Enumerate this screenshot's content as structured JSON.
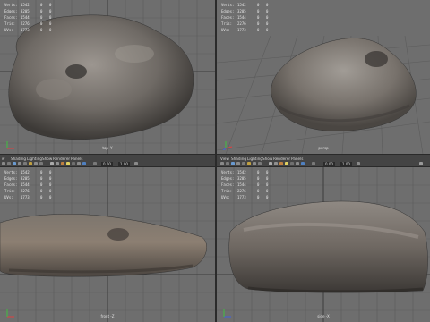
{
  "stats_labels": [
    "Verts:",
    "Edges:",
    "Faces:",
    "Tris:",
    "UVs:"
  ],
  "viewports": {
    "top": {
      "camera": "top -Y",
      "rows": [
        {
          "v1": "1542",
          "v2": "0",
          "v3": "0"
        },
        {
          "v1": "3205",
          "v2": "0",
          "v3": "0"
        },
        {
          "v1": "1544",
          "v2": "0",
          "v3": "0"
        },
        {
          "v1": "2276",
          "v2": "0",
          "v3": "0"
        },
        {
          "v1": "1773",
          "v2": "0",
          "v3": "0"
        }
      ]
    },
    "persp": {
      "camera": "persp",
      "rows": [
        {
          "v1": "1542",
          "v2": "0",
          "v3": "0"
        },
        {
          "v1": "3205",
          "v2": "0",
          "v3": "0"
        },
        {
          "v1": "1544",
          "v2": "0",
          "v3": "0"
        },
        {
          "v1": "2276",
          "v2": "0",
          "v3": "0"
        },
        {
          "v1": "1773",
          "v2": "0",
          "v3": "0"
        }
      ]
    },
    "front": {
      "camera": "front -Z",
      "rows": [
        {
          "v1": "1542",
          "v2": "0",
          "v3": "0"
        },
        {
          "v1": "3205",
          "v2": "0",
          "v3": "0"
        },
        {
          "v1": "1544",
          "v2": "0",
          "v3": "0"
        },
        {
          "v1": "2276",
          "v2": "0",
          "v3": "0"
        },
        {
          "v1": "1773",
          "v2": "0",
          "v3": "0"
        }
      ]
    },
    "side": {
      "camera": "side -X",
      "rows": [
        {
          "v1": "1542",
          "v2": "0",
          "v3": "0"
        },
        {
          "v1": "3205",
          "v2": "0",
          "v3": "0"
        },
        {
          "v1": "1544",
          "v2": "0",
          "v3": "0"
        },
        {
          "v1": "2276",
          "v2": "0",
          "v3": "0"
        },
        {
          "v1": "1773",
          "v2": "0",
          "v3": "0"
        }
      ]
    }
  },
  "menus": {
    "left": [
      "w",
      "Shading",
      "Lighting",
      "Show",
      "Renderer",
      "Panels"
    ],
    "right": [
      "View",
      "Shading",
      "Lighting",
      "Show",
      "Renderer",
      "Panels"
    ]
  },
  "toolbar": {
    "left": {
      "field1": "0.00",
      "field2": "1.00"
    },
    "right": {
      "field1": "0.00",
      "field2": "1.00"
    }
  },
  "colors": {
    "viewport_bg": "#6e6e6e",
    "grid": "#5c5c5c",
    "grid_axis": "#3c3c3c",
    "rock_light": "#8d8883",
    "rock_dark": "#4b4744"
  }
}
